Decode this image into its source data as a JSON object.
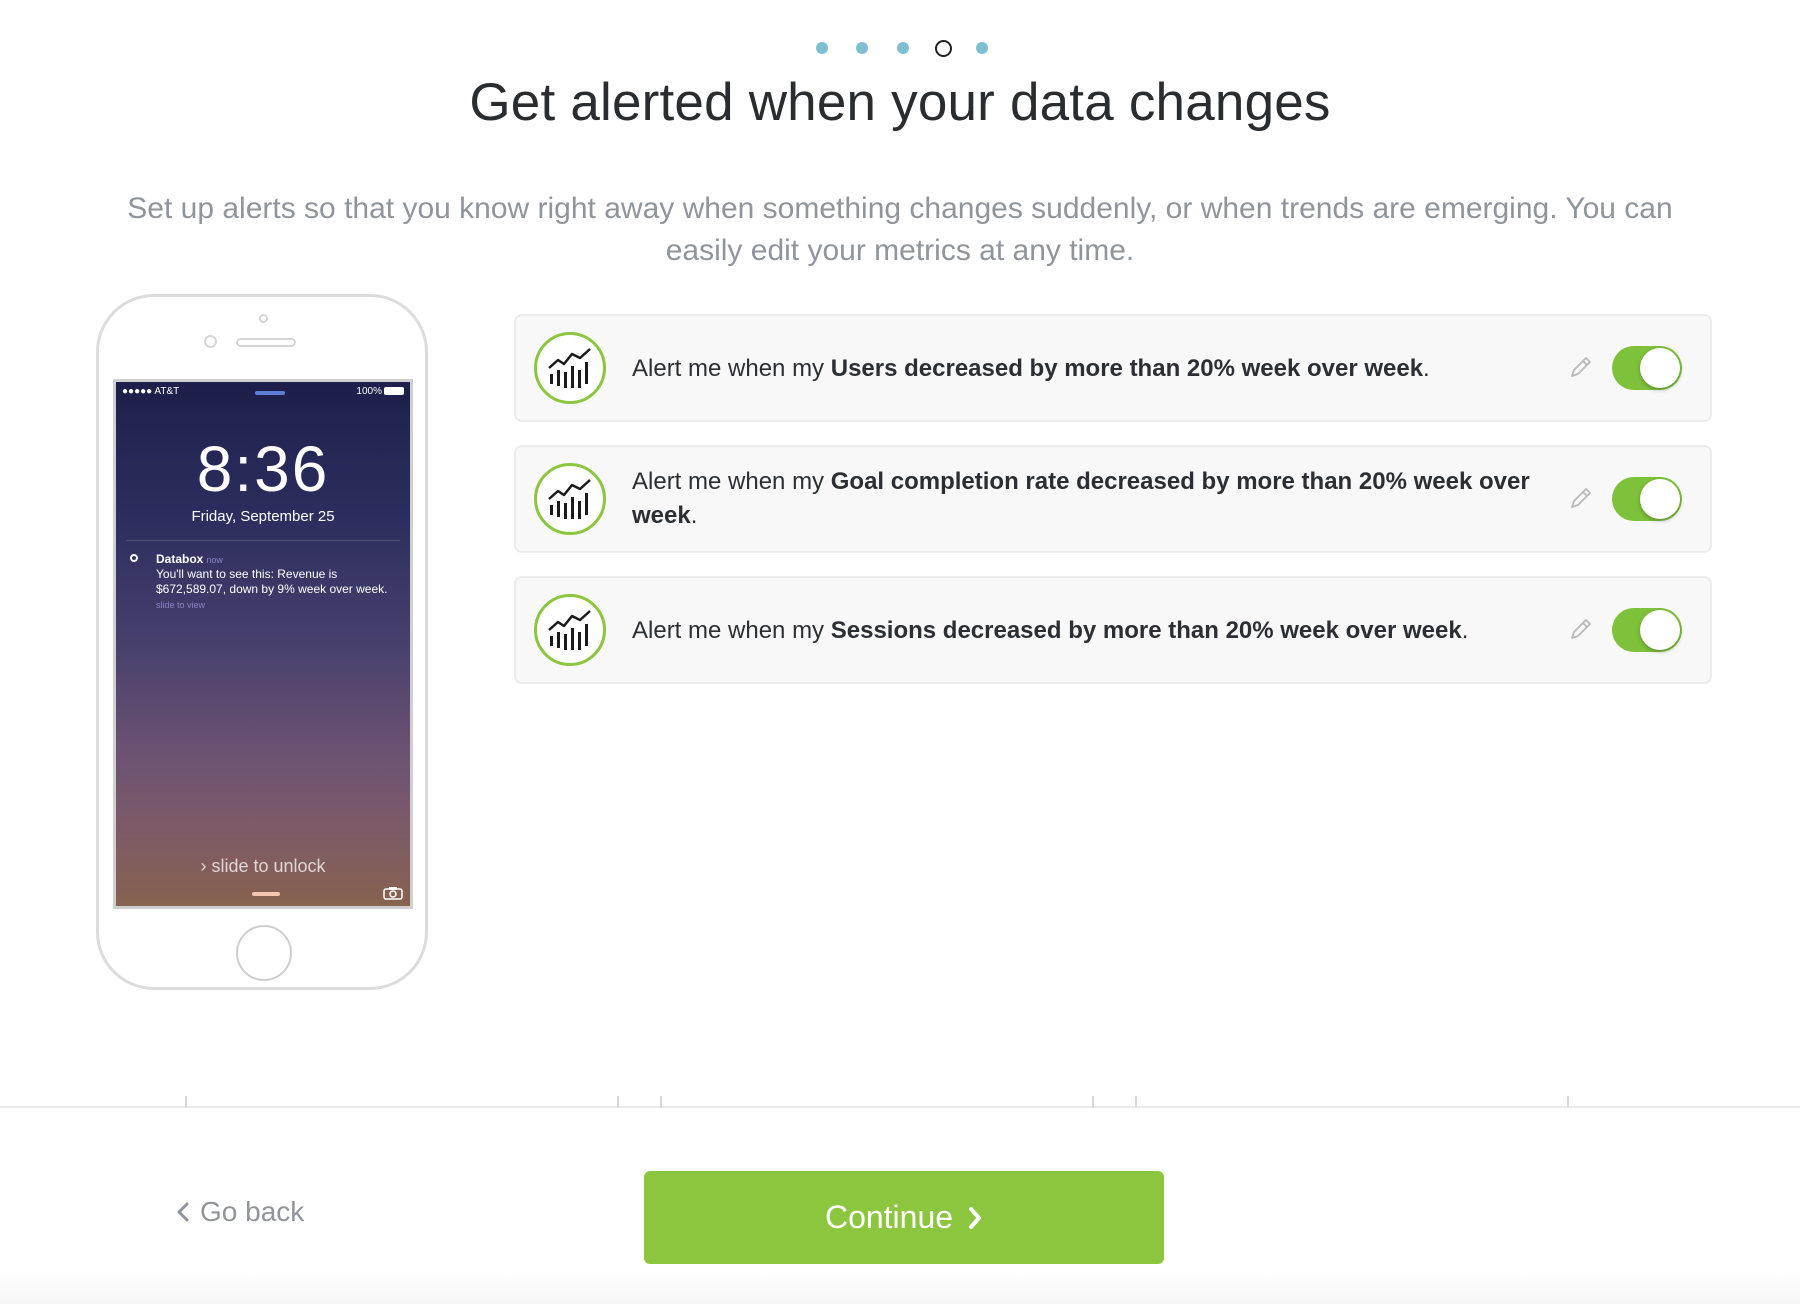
{
  "stepper": {
    "total": 5,
    "current": 4
  },
  "header": {
    "title": "Get alerted when your data changes",
    "subtitle": "Set up alerts so that you know right away when something changes suddenly, or when trends are emerging. You can easily edit your metrics at any time."
  },
  "phone": {
    "carrier": "●●●●● AT&T",
    "battery": "100%",
    "time": "8:36",
    "date": "Friday, September 25",
    "notification": {
      "app": "Databox",
      "when": "now",
      "message": "You'll want to see this: Revenue is $672,589.07, down by 9% week over week.",
      "hint": "slide to view"
    },
    "unlock_text": "slide to unlock"
  },
  "alerts": [
    {
      "prefix": "Alert me when my ",
      "bold": "Users decreased by more than 20% week over week",
      "suffix": ".",
      "enabled": true
    },
    {
      "prefix": "Alert me when my ",
      "bold": "Goal completion rate decreased by more than 20% week over week",
      "suffix": ".",
      "enabled": true
    },
    {
      "prefix": "Alert me when my ",
      "bold": "Sessions decreased by more than 20% week over week",
      "suffix": ".",
      "enabled": true
    }
  ],
  "footer": {
    "back_label": "Go back",
    "continue_label": "Continue"
  },
  "colors": {
    "accent_green": "#8cc63f",
    "toggle_green": "#7ec13a",
    "dot_blue": "#7fbfd3",
    "muted_text": "#8f959b"
  },
  "icons": {
    "alert_badge": "bar-chart-trend-icon",
    "edit": "pencil-icon",
    "back": "chevron-left-icon",
    "continue": "chevron-right-icon"
  }
}
